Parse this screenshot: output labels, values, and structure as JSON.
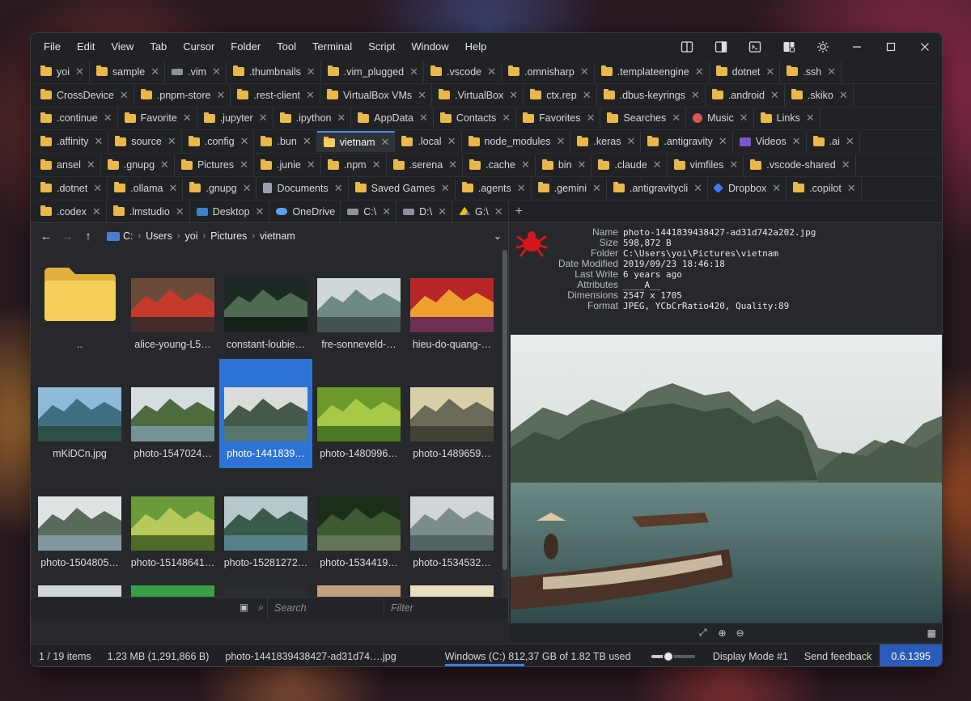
{
  "menu": [
    "File",
    "Edit",
    "View",
    "Tab",
    "Cursor",
    "Folder",
    "Tool",
    "Terminal",
    "Script",
    "Window",
    "Help"
  ],
  "tab_rows": [
    [
      {
        "label": "yoi"
      },
      {
        "label": "sample"
      },
      {
        "label": ".vim",
        "icon": "drive"
      },
      {
        "label": ".thumbnails"
      },
      {
        "label": ".vim_plugged"
      },
      {
        "label": ".vscode"
      },
      {
        "label": ".omnisharp"
      },
      {
        "label": ".templateengine"
      },
      {
        "label": "dotnet"
      },
      {
        "label": ".ssh"
      }
    ],
    [
      {
        "label": "CrossDevice"
      },
      {
        "label": ".pnpm-store"
      },
      {
        "label": ".rest-client"
      },
      {
        "label": "VirtualBox VMs"
      },
      {
        "label": ".VirtualBox"
      },
      {
        "label": "ctx.rep"
      },
      {
        "label": ".dbus-keyrings"
      },
      {
        "label": ".android"
      },
      {
        "label": ".skiko"
      }
    ],
    [
      {
        "label": ".continue"
      },
      {
        "label": "Favorite"
      },
      {
        "label": ".jupyter"
      },
      {
        "label": ".ipython"
      },
      {
        "label": "AppData"
      },
      {
        "label": "Contacts"
      },
      {
        "label": "Favorites"
      },
      {
        "label": "Searches"
      },
      {
        "label": "Music",
        "icon": "music"
      },
      {
        "label": "Links"
      }
    ],
    [
      {
        "label": ".affinity"
      },
      {
        "label": "source"
      },
      {
        "label": ".config"
      },
      {
        "label": ".bun"
      },
      {
        "label": "vietnam",
        "active": true
      },
      {
        "label": ".local"
      },
      {
        "label": "node_modules"
      },
      {
        "label": ".keras"
      },
      {
        "label": ".antigravity"
      },
      {
        "label": "Videos",
        "icon": "video"
      },
      {
        "label": ".ai"
      }
    ],
    [
      {
        "label": "ansel"
      },
      {
        "label": ".gnupg"
      },
      {
        "label": "Pictures"
      },
      {
        "label": ".junie"
      },
      {
        "label": ".npm"
      },
      {
        "label": ".serena"
      },
      {
        "label": ".cache"
      },
      {
        "label": "bin"
      },
      {
        "label": ".claude"
      },
      {
        "label": "vimfiles"
      },
      {
        "label": ".vscode-shared"
      }
    ],
    [
      {
        "label": ".dotnet"
      },
      {
        "label": ".ollama"
      },
      {
        "label": ".gnupg"
      },
      {
        "label": "Documents",
        "icon": "docs"
      },
      {
        "label": "Saved Games"
      },
      {
        "label": ".agents"
      },
      {
        "label": ".gemini"
      },
      {
        "label": ".antigravitycli"
      },
      {
        "label": "Dropbox",
        "icon": "dropbox"
      },
      {
        "label": ".copilot"
      }
    ],
    [
      {
        "label": ".codex"
      },
      {
        "label": ".lmstudio"
      },
      {
        "label": "Desktop",
        "icon": "desktop"
      },
      {
        "label": "OneDrive",
        "icon": "cloud",
        "noclose": true
      },
      {
        "label": "C:\\",
        "icon": "drive"
      },
      {
        "label": "D:\\",
        "icon": "drive"
      },
      {
        "label": "G:\\",
        "icon": "gdrive"
      },
      {
        "label": "+",
        "plus": true
      }
    ]
  ],
  "breadcrumb": [
    "C:",
    "Users",
    "yoi",
    "Pictures",
    "vietnam"
  ],
  "files": [
    {
      "name": "..",
      "kind": "folder"
    },
    {
      "name": "alice-young-L5…",
      "hue": "market"
    },
    {
      "name": "constant-loubie…",
      "hue": "cave"
    },
    {
      "name": "fre-sonneveld-…",
      "hue": "bay"
    },
    {
      "name": "hieu-do-quang-…",
      "hue": "lanterns"
    },
    {
      "name": "mKiDCn.jpg",
      "hue": "sky"
    },
    {
      "name": "photo-1547024…",
      "hue": "islet"
    },
    {
      "name": "photo-1441839…",
      "hue": "bay2",
      "selected": true
    },
    {
      "name": "photo-1480996…",
      "hue": "rice"
    },
    {
      "name": "photo-1489659…",
      "hue": "fog"
    },
    {
      "name": "photo-1504805…",
      "hue": "cliff"
    },
    {
      "name": "photo-15148641…",
      "hue": "fields"
    },
    {
      "name": "photo-15281272…",
      "hue": "bay3"
    },
    {
      "name": "photo-1534419…",
      "hue": "forest"
    },
    {
      "name": "photo-1534532…",
      "hue": "grey"
    }
  ],
  "meta": [
    {
      "k": "Name",
      "v": "photo-1441839438427-ad31d742a202.jpg"
    },
    {
      "k": "Size",
      "v": "598,872 B"
    },
    {
      "k": "Folder",
      "v": "C:\\Users\\yoi\\Pictures\\vietnam"
    },
    {
      "k": "Date Modified",
      "v": "2019/09/23 18:46:18"
    },
    {
      "k": "Last Write",
      "v": "6 years ago"
    },
    {
      "k": "Attributes",
      "v": "____A__"
    },
    {
      "k": "Dimensions",
      "v": "2547 x 1705"
    },
    {
      "k": "Format",
      "v": "JPEG, YCbCrRatio420, Quality:89"
    }
  ],
  "filter": {
    "search_placeholder": "Search",
    "filter_placeholder": "Filter"
  },
  "status": {
    "items": "1 / 19 items",
    "size": "1.23 MB  (1,291,866 B)",
    "file": "photo-1441839438427-ad31d74….jpg",
    "drive": "Windows (C:) 812,37 GB of 1.82 TB used",
    "zoom_level": 0.38,
    "display_mode": "Display Mode #1",
    "feedback": "Send feedback",
    "version": "0.6.1395"
  },
  "colors": {
    "accent": "#2d73d6",
    "folder": "#e8b84a",
    "version_bg": "#2a5bb8"
  }
}
